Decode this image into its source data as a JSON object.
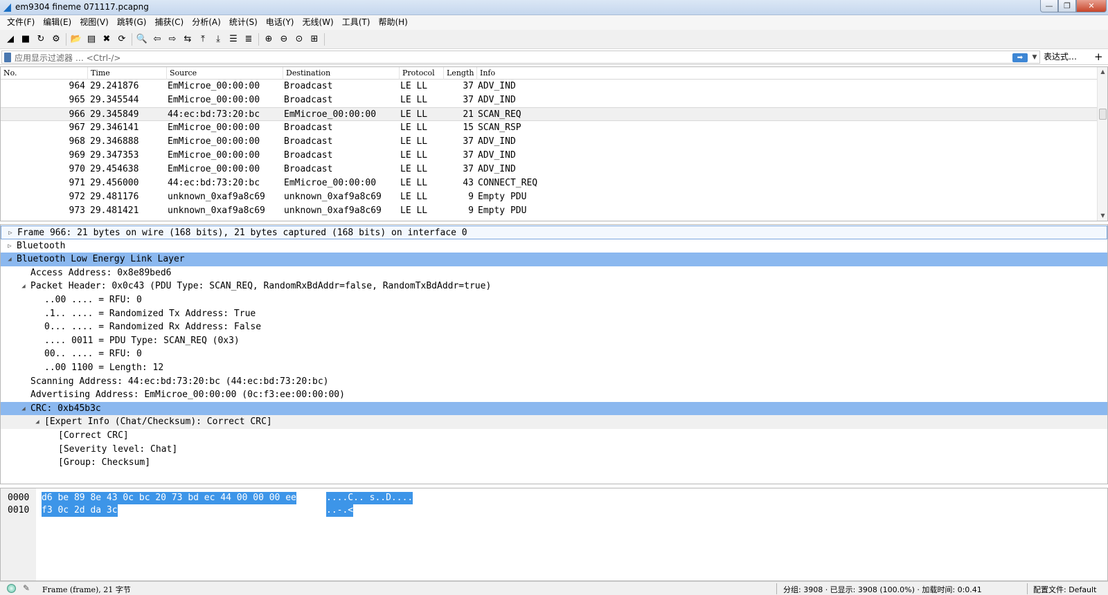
{
  "window": {
    "title": "em9304 fineme 071117.pcapng",
    "buttons": {
      "minimize": "—",
      "restore": "❐",
      "close": "✕"
    }
  },
  "menu": [
    "文件(F)",
    "编辑(E)",
    "视图(V)",
    "跳转(G)",
    "捕获(C)",
    "分析(A)",
    "统计(S)",
    "电话(Y)",
    "无线(W)",
    "工具(T)",
    "帮助(H)"
  ],
  "toolbar": {
    "icons": [
      "shark-fin-start-icon",
      "stop-icon",
      "restart-icon",
      "capture-options-icon",
      "open-file-icon",
      "save-file-icon",
      "close-file-icon",
      "reload-icon",
      "find-icon",
      "go-back-icon",
      "go-forward-icon",
      "go-to-packet-icon",
      "first-packet-icon",
      "last-packet-icon",
      "autoscroll-icon",
      "colorize-icon",
      "zoom-in-icon",
      "zoom-out-icon",
      "zoom-normal-icon",
      "resize-columns-icon"
    ],
    "glyphs": [
      "◢",
      "■",
      "↻",
      "⚙",
      "📂",
      "▤",
      "✖",
      "⟳",
      "🔍",
      "⇦",
      "⇨",
      "⇆",
      "⤒",
      "⤓",
      "☰",
      "≣",
      "⊕",
      "⊖",
      "⊙",
      "⊞"
    ]
  },
  "filter": {
    "placeholder": "应用显示过滤器 … <Ctrl-/>",
    "apply_label": "➡",
    "dropdown": "▼",
    "expression_label": "表达式…",
    "add_label": "+"
  },
  "packet_list": {
    "columns": [
      "No.",
      "Time",
      "Source",
      "Destination",
      "Protocol",
      "Length",
      "Info"
    ],
    "selected_no": "966",
    "rows": [
      {
        "no": "964",
        "time": "29.241876",
        "src": "EmMicroe_00:00:00",
        "dst": "Broadcast",
        "proto": "LE LL",
        "len": "37",
        "info": "ADV_IND"
      },
      {
        "no": "965",
        "time": "29.345544",
        "src": "EmMicroe_00:00:00",
        "dst": "Broadcast",
        "proto": "LE LL",
        "len": "37",
        "info": "ADV_IND"
      },
      {
        "no": "966",
        "time": "29.345849",
        "src": "44:ec:bd:73:20:bc",
        "dst": "EmMicroe_00:00:00",
        "proto": "LE LL",
        "len": "21",
        "info": "SCAN_REQ"
      },
      {
        "no": "967",
        "time": "29.346141",
        "src": "EmMicroe_00:00:00",
        "dst": "Broadcast",
        "proto": "LE LL",
        "len": "15",
        "info": "SCAN_RSP"
      },
      {
        "no": "968",
        "time": "29.346888",
        "src": "EmMicroe_00:00:00",
        "dst": "Broadcast",
        "proto": "LE LL",
        "len": "37",
        "info": "ADV_IND"
      },
      {
        "no": "969",
        "time": "29.347353",
        "src": "EmMicroe_00:00:00",
        "dst": "Broadcast",
        "proto": "LE LL",
        "len": "37",
        "info": "ADV_IND"
      },
      {
        "no": "970",
        "time": "29.454638",
        "src": "EmMicroe_00:00:00",
        "dst": "Broadcast",
        "proto": "LE LL",
        "len": "37",
        "info": "ADV_IND"
      },
      {
        "no": "971",
        "time": "29.456000",
        "src": "44:ec:bd:73:20:bc",
        "dst": "EmMicroe_00:00:00",
        "proto": "LE LL",
        "len": "43",
        "info": "CONNECT_REQ"
      },
      {
        "no": "972",
        "time": "29.481176",
        "src": "unknown_0xaf9a8c69",
        "dst": "unknown_0xaf9a8c69",
        "proto": "LE LL",
        "len": "9",
        "info": "Empty PDU"
      },
      {
        "no": "973",
        "time": "29.481421",
        "src": "unknown_0xaf9a8c69",
        "dst": "unknown_0xaf9a8c69",
        "proto": "LE LL",
        "len": "9",
        "info": "Empty PDU"
      }
    ]
  },
  "details": [
    {
      "text": "Frame 966: 21 bytes on wire (168 bits), 21 bytes captured (168 bits) on interface 0",
      "level": 0,
      "twisty": "▷",
      "style": "outlined"
    },
    {
      "text": "Bluetooth",
      "level": 0,
      "twisty": "▷",
      "style": ""
    },
    {
      "text": "Bluetooth Low Energy Link Layer",
      "level": 0,
      "twisty": "◢",
      "style": "hl"
    },
    {
      "text": "Access Address: 0x8e89bed6",
      "level": 1,
      "twisty": "",
      "style": ""
    },
    {
      "text": "Packet Header: 0x0c43 (PDU Type: SCAN_REQ, RandomRxBdAddr=false, RandomTxBdAddr=true)",
      "level": 1,
      "twisty": "◢",
      "style": ""
    },
    {
      "text": "..00 .... = RFU: 0",
      "level": 2,
      "twisty": "",
      "style": ""
    },
    {
      "text": ".1.. .... = Randomized Tx Address: True",
      "level": 2,
      "twisty": "",
      "style": ""
    },
    {
      "text": "0... .... = Randomized Rx Address: False",
      "level": 2,
      "twisty": "",
      "style": ""
    },
    {
      "text": ".... 0011 = PDU Type: SCAN_REQ (0x3)",
      "level": 2,
      "twisty": "",
      "style": ""
    },
    {
      "text": "00.. .... = RFU: 0",
      "level": 2,
      "twisty": "",
      "style": ""
    },
    {
      "text": "..00 1100 = Length: 12",
      "level": 2,
      "twisty": "",
      "style": ""
    },
    {
      "text": "Scanning Address: 44:ec:bd:73:20:bc (44:ec:bd:73:20:bc)",
      "level": 1,
      "twisty": "",
      "style": ""
    },
    {
      "text": "Advertising Address: EmMicroe_00:00:00 (0c:f3:ee:00:00:00)",
      "level": 1,
      "twisty": "",
      "style": ""
    },
    {
      "text": "CRC: 0xb45b3c",
      "level": 1,
      "twisty": "◢",
      "style": "hl"
    },
    {
      "text": "[Expert Info (Chat/Checksum): Correct CRC]",
      "level": 2,
      "twisty": "◢",
      "style": "grey"
    },
    {
      "text": "[Correct CRC]",
      "level": 3,
      "twisty": "",
      "style": ""
    },
    {
      "text": "[Severity level: Chat]",
      "level": 3,
      "twisty": "",
      "style": ""
    },
    {
      "text": "[Group: Checksum]",
      "level": 3,
      "twisty": "",
      "style": ""
    }
  ],
  "bytes": [
    {
      "offset": "0000",
      "hex": "d6 be 89 8e 43 0c bc 20  73 bd ec 44 00 00 00 ee",
      "ascii": "....C..  s..D...."
    },
    {
      "offset": "0010",
      "hex": "f3 0c 2d da 3c",
      "ascii": "..-.<"
    }
  ],
  "status": {
    "frame_info": "Frame (frame), 21 字节",
    "stats": "分组: 3908 · 已显示: 3908 (100.0%) · 加载时间: 0:0.41",
    "profile": "配置文件: Default"
  },
  "colors": {
    "selection_highlight": "#8bb8ef",
    "hex_selection": "#3d95e8",
    "row_selected": "#f0f0f0"
  }
}
